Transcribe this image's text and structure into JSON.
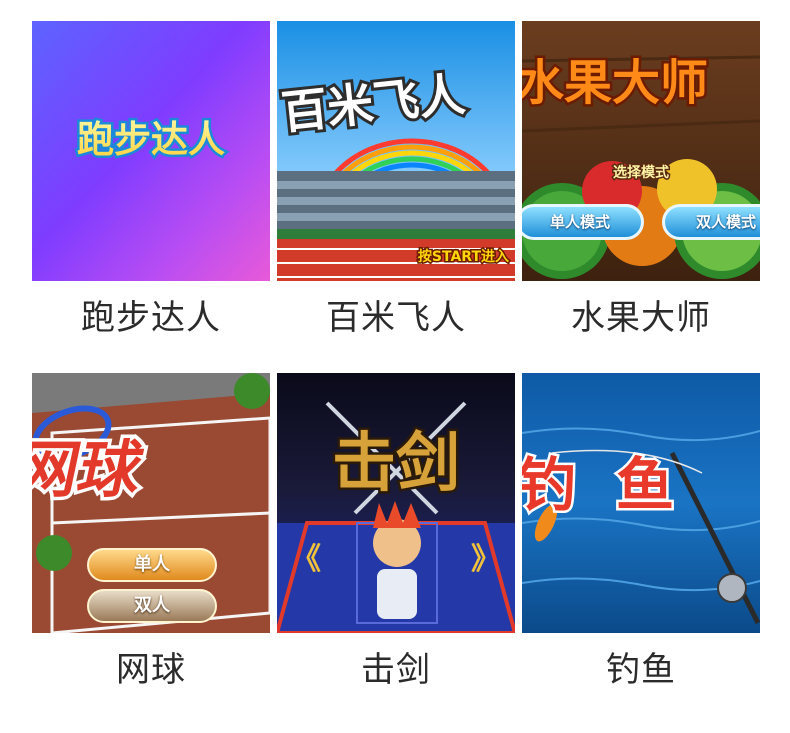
{
  "games": [
    {
      "id": "running",
      "title": "跑步达人",
      "banner": "跑步达人",
      "accent": "#6a56f0"
    },
    {
      "id": "sprint",
      "title": "百米飞人",
      "banner": "百米飞人",
      "start_hint": "按START进入",
      "accent": "#e13b2b"
    },
    {
      "id": "fruit",
      "title": "水果大师",
      "banner": "水果大师",
      "mode_prompt": "选择模式",
      "single_mode": "单人模式",
      "double_mode": "双人模式",
      "accent": "#7a4a24"
    },
    {
      "id": "tennis",
      "title": "网球",
      "banner": "网球",
      "single": "单人",
      "double": "双人",
      "accent": "#8a3a26"
    },
    {
      "id": "fencing",
      "title": "击剑",
      "banner": "击剑",
      "prev_arrow": "《",
      "next_arrow": "》",
      "accent": "#1b2a8a"
    },
    {
      "id": "fishing",
      "title": "钓鱼",
      "banner": "钓鱼",
      "accent": "#0f5fa8"
    }
  ]
}
